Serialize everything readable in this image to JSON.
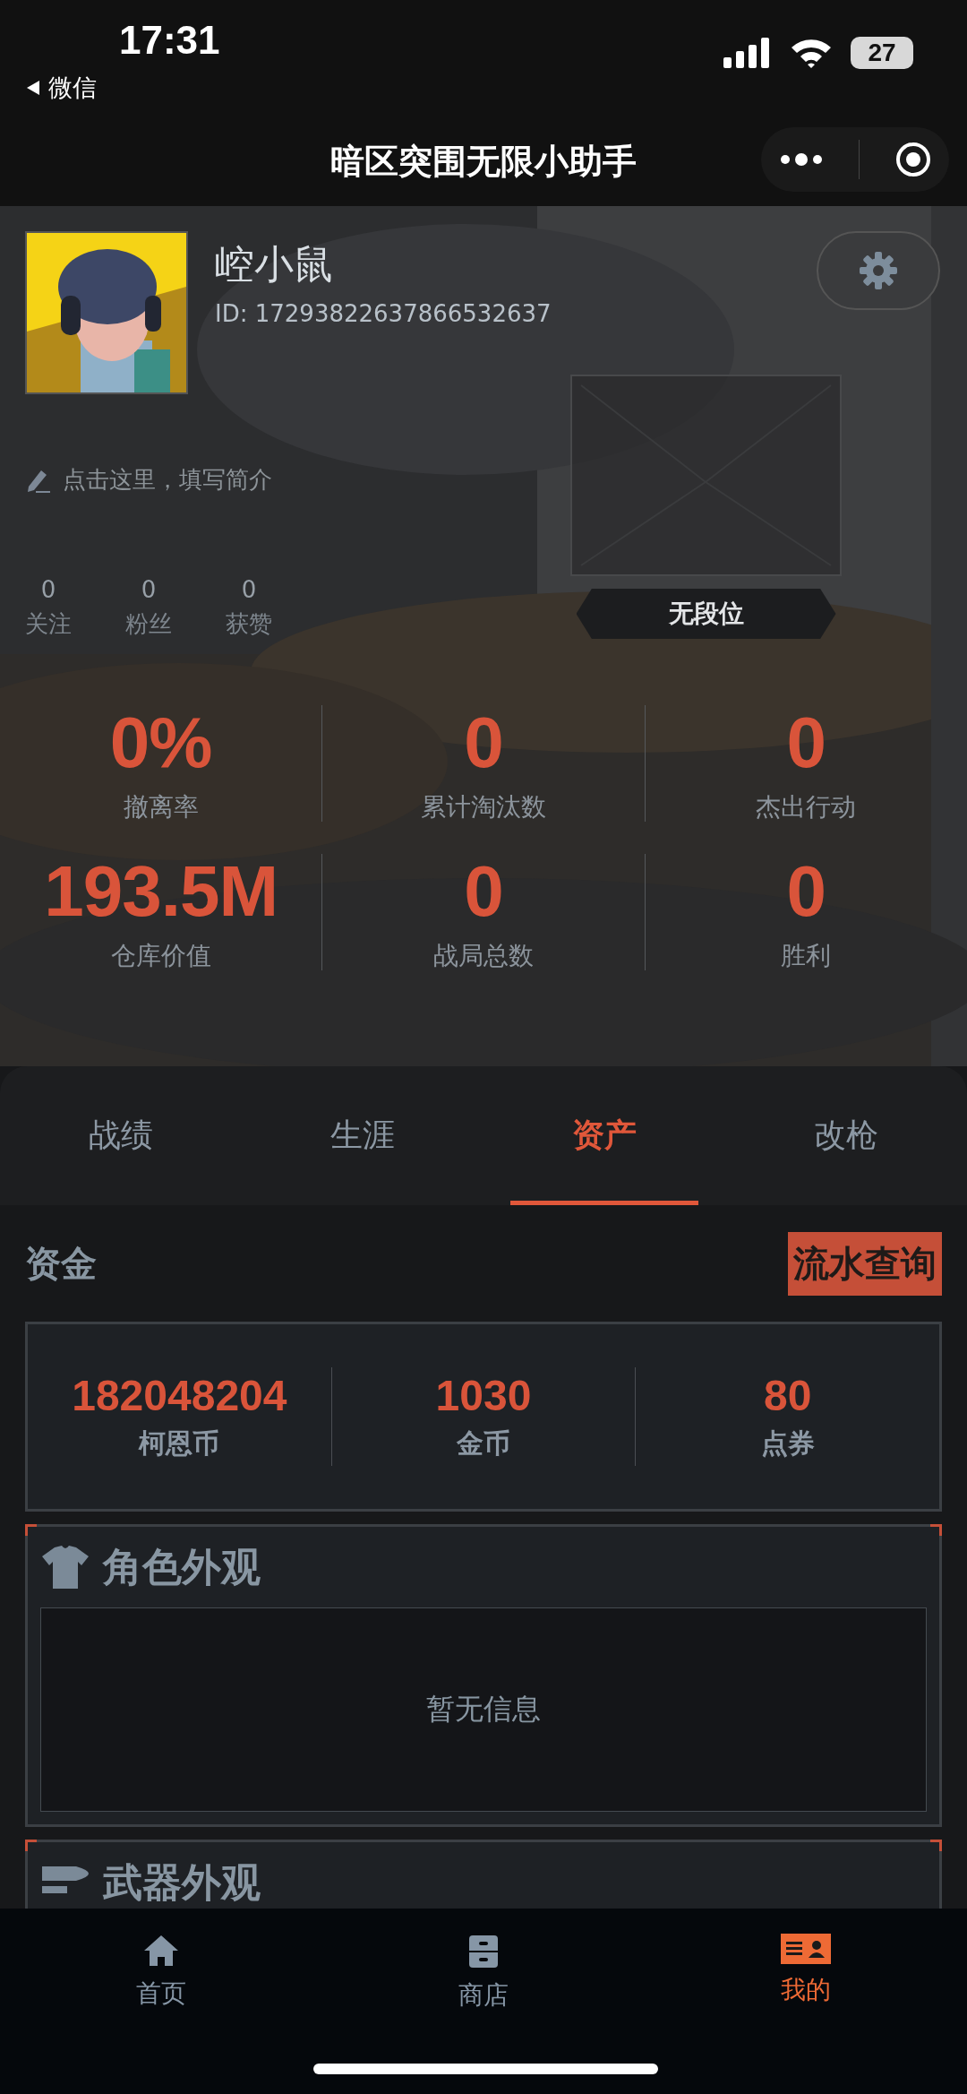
{
  "status": {
    "time": "17:31",
    "back": "微信",
    "battery": "27"
  },
  "title": "暗区突围无限小助手",
  "profile": {
    "name": "崆小鼠",
    "id": "ID: 17293822637866532637",
    "bio_hint": "点击这里，填写简介",
    "rank": "无段位",
    "social": [
      {
        "value": "0",
        "label": "关注"
      },
      {
        "value": "0",
        "label": "粉丝"
      },
      {
        "value": "0",
        "label": "获赞"
      }
    ]
  },
  "stats": [
    {
      "value": "0%",
      "label": "撤离率"
    },
    {
      "value": "0",
      "label": "累计淘汰数"
    },
    {
      "value": "0",
      "label": "杰出行动"
    },
    {
      "value": "193.5M",
      "label": "仓库价值"
    },
    {
      "value": "0",
      "label": "战局总数"
    },
    {
      "value": "0",
      "label": "胜利"
    }
  ],
  "tabs": [
    {
      "label": "战绩",
      "selected": false
    },
    {
      "label": "生涯",
      "selected": false
    },
    {
      "label": "资产",
      "selected": true
    },
    {
      "label": "改枪",
      "selected": false
    }
  ],
  "funds": {
    "title": "资金",
    "button": "流水查询",
    "currencies": [
      {
        "value": "182048204",
        "label": "柯恩币"
      },
      {
        "value": "1030",
        "label": "金币"
      },
      {
        "value": "80",
        "label": "点券"
      }
    ]
  },
  "sections": [
    {
      "title": "角色外观",
      "empty_text": "暂无信息"
    },
    {
      "title": "武器外观"
    }
  ],
  "nav": [
    {
      "label": "首页",
      "selected": false
    },
    {
      "label": "商店",
      "selected": false
    },
    {
      "label": "我的",
      "selected": true
    }
  ]
}
